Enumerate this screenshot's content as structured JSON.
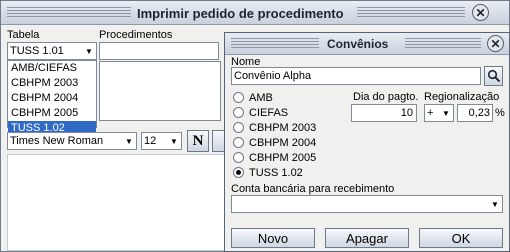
{
  "back_window": {
    "title": "Imprimir pedido de procedimento",
    "tabela_label": "Tabela",
    "procedimentos_label": "Procedimentos",
    "tabela_selected": "TUSS 1.01",
    "tabela_options": [
      "AMB/CIEFAS",
      "CBHPM 2003",
      "CBHPM 2004",
      "CBHPM 2005",
      "TUSS 1.02"
    ],
    "font_name": "Times New Roman",
    "font_size": "12",
    "bold_label": "N"
  },
  "dialog": {
    "title": "Convênios",
    "nome_label": "Nome",
    "nome_value": "Convênio Alpha",
    "radio_options": [
      "AMB",
      "CIEFAS",
      "CBHPM 2003",
      "CBHPM 2004",
      "CBHPM 2005",
      "TUSS 1.02"
    ],
    "selected_option": "TUSS 1.02",
    "dia_label": "Dia do pagto.",
    "dia_value": "10",
    "regionalizacao_label": "Regionalização",
    "regionalizacao_sign": "+",
    "regionalizacao_value": "0,23",
    "percent_symbol": "%",
    "conta_label": "Conta bancária para recebimento",
    "conta_value": "",
    "buttons": {
      "novo": "Novo",
      "apagar": "Apagar",
      "ok": "OK"
    }
  },
  "icons": {
    "close": "close-icon",
    "search": "search-icon",
    "dropdown": "chevron-down-icon"
  }
}
